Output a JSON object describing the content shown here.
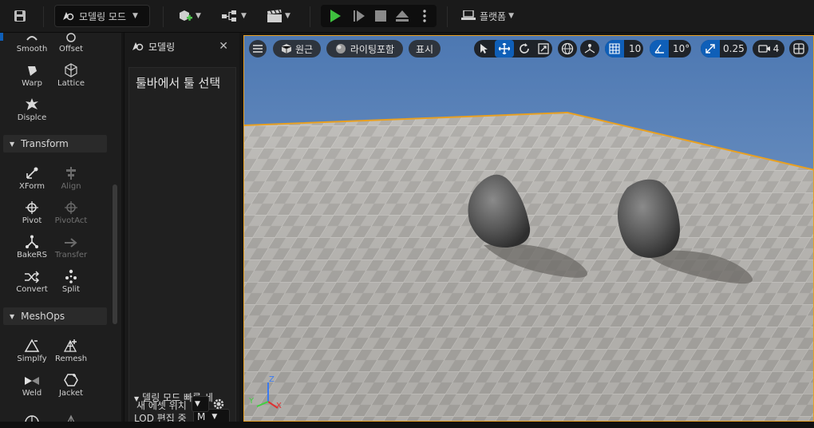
{
  "toolbar": {
    "mode_label": "모델링 모드",
    "platforms_label": "플랫폼"
  },
  "palette": {
    "top_items": [
      {
        "label": "Smooth",
        "icon": "smooth-icon"
      },
      {
        "label": "Offset",
        "icon": "offset-icon"
      },
      {
        "label": "Warp",
        "icon": "warp-icon"
      },
      {
        "label": "Lattice",
        "icon": "lattice-icon"
      },
      {
        "label": "Displce",
        "icon": "displace-icon"
      }
    ],
    "transform_header": "Transform",
    "transform_items": [
      {
        "label": "XForm",
        "enabled": true
      },
      {
        "label": "Align",
        "enabled": false
      },
      {
        "label": "Pivot",
        "enabled": true
      },
      {
        "label": "PivotAct",
        "enabled": false
      },
      {
        "label": "BakeRS",
        "enabled": true
      },
      {
        "label": "Transfer",
        "enabled": false
      },
      {
        "label": "Convert",
        "enabled": true
      },
      {
        "label": "Split",
        "enabled": true
      }
    ],
    "meshops_header": "MeshOps",
    "meshops_items": [
      {
        "label": "Simplfy"
      },
      {
        "label": "Remesh"
      },
      {
        "label": "Weld"
      },
      {
        "label": "Jacket"
      }
    ]
  },
  "modeling_panel": {
    "tab_label": "모델링",
    "title": "툴바에서 툴 선택",
    "quick_settings": "델링 모드 빠른 세",
    "lod_label": "LOD 편집 중",
    "lod_value": "M",
    "asset_location_label": "새 에셋 위치"
  },
  "viewport": {
    "perspective_label": "원근",
    "lighting_label": "라이팅포함",
    "show_label": "표시",
    "grid_snap_value": "10",
    "rotation_snap_value": "10°",
    "scale_snap_value": "0.25",
    "camera_speed_value": "4",
    "axis": {
      "x": "X",
      "y": "Y",
      "z": "Z"
    }
  },
  "colors": {
    "accent_blue": "#0f5fb8",
    "play_green": "#3fbf3f",
    "viewport_border": "#e8a022"
  }
}
